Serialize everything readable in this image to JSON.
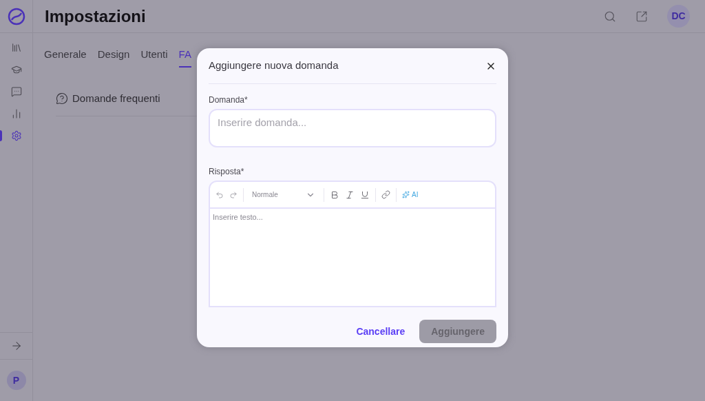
{
  "header": {
    "title": "Impostazioni",
    "avatar": "DC"
  },
  "sidebar": {
    "items": [
      {
        "selected": false
      },
      {
        "selected": false
      },
      {
        "selected": false
      },
      {
        "selected": false
      },
      {
        "selected": true
      }
    ],
    "user_avatar": "P"
  },
  "tabs": [
    {
      "label": "Generale",
      "selected": false
    },
    {
      "label": "Design",
      "selected": false
    },
    {
      "label": "Utenti",
      "selected": false
    },
    {
      "label": "FA",
      "selected": true
    }
  ],
  "section": {
    "title": "Domande frequenti"
  },
  "modal": {
    "title": "Aggiungere nuova domanda",
    "question": {
      "label": "Domanda*",
      "placeholder": "Inserire domanda..."
    },
    "answer": {
      "label": "Risposta*",
      "placeholder": "Inserire testo...",
      "style_select": "Normale",
      "ai_label": "AI"
    },
    "buttons": [
      {
        "label": "Cancellare",
        "kind": "link",
        "disabled": false
      },
      {
        "label": "Aggiungere",
        "kind": "primary",
        "disabled": true
      }
    ]
  }
}
